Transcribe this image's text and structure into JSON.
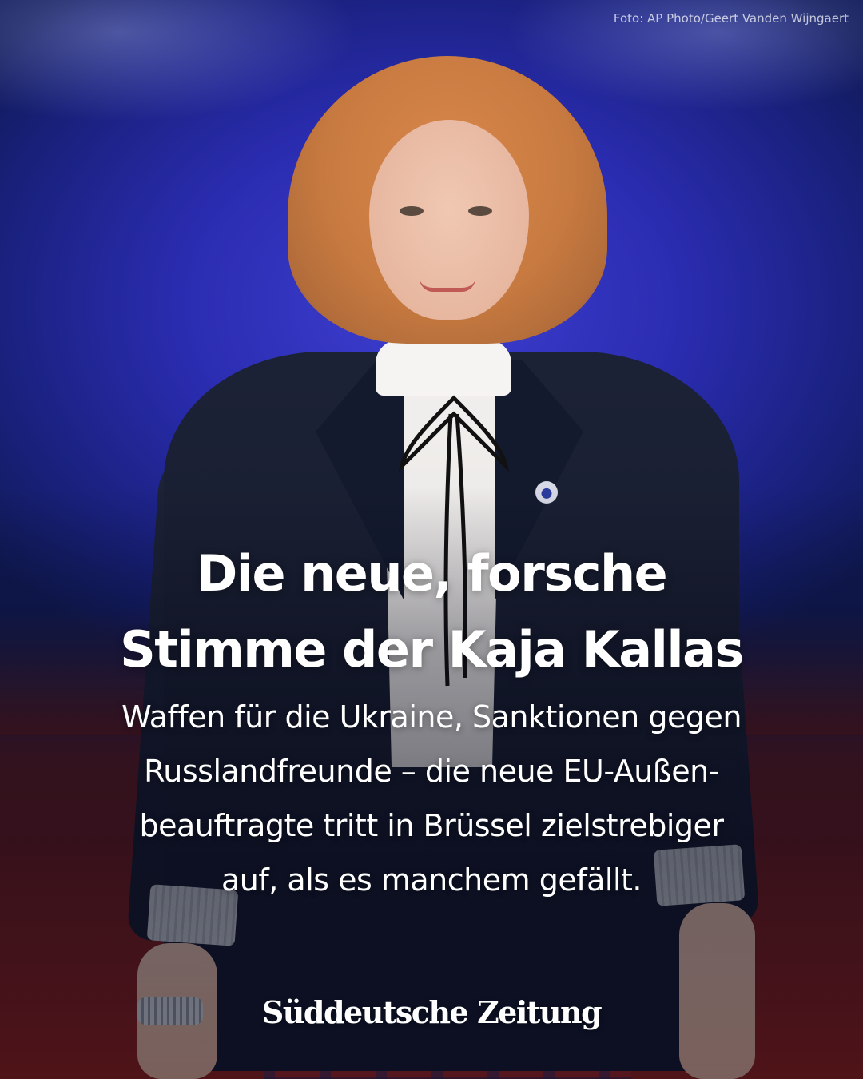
{
  "photo_credit": "Foto: AP Photo/Geert Vanden Wijngaert",
  "headline": {
    "line1": "Die neue, forsche",
    "line2": "Stimme der Kaja Kallas"
  },
  "teaser": {
    "line1": "Waffen für die Ukraine, Sanktionen gegen",
    "line2": "Russlandfreunde – die neue EU-Außen-",
    "line3": "beauftragte tritt in Brüssel zielstrebiger",
    "line4": "auf, als es manchem gefällt."
  },
  "brand": {
    "logo_text": "Süddeutsche Zeitung"
  },
  "colors": {
    "background": "#2a2cb0",
    "carpet": "#8a1d18",
    "text": "#ffffff"
  }
}
